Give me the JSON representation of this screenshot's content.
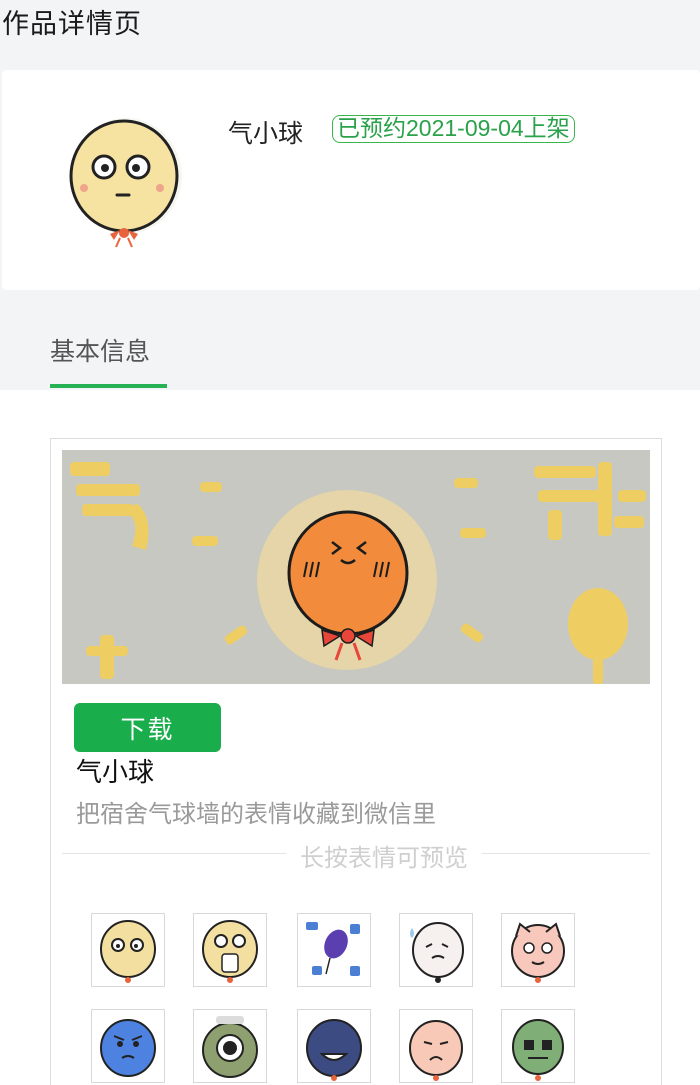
{
  "page": {
    "title": "作品详情页"
  },
  "work": {
    "name": "气小球",
    "status": "已预约2021-09-04上架"
  },
  "tabs": [
    {
      "label": "基本信息",
      "active": true
    }
  ],
  "pack": {
    "download_label": "下载",
    "name": "气小球",
    "description": "把宿舍气球墙的表情收藏到微信里",
    "preview_hint": "长按表情可预览"
  },
  "stickers": [
    {
      "icon": "yellow-balloon-wide-eyes-icon"
    },
    {
      "icon": "yellow-balloon-crying-icon"
    },
    {
      "icon": "purple-balloon-text-icon"
    },
    {
      "icon": "white-balloon-tear-icon"
    },
    {
      "icon": "pink-cat-balloon-icon"
    },
    {
      "icon": "blue-balloon-angry-icon"
    },
    {
      "icon": "green-one-eye-balloon-icon"
    },
    {
      "icon": "navy-balloon-grin-icon"
    },
    {
      "icon": "peach-balloon-frown-icon"
    },
    {
      "icon": "green-balloon-mask-icon"
    }
  ],
  "colors": {
    "accent": "#1aad4b",
    "status": "#2aa14a",
    "banner_bg": "#c6c8c1"
  }
}
